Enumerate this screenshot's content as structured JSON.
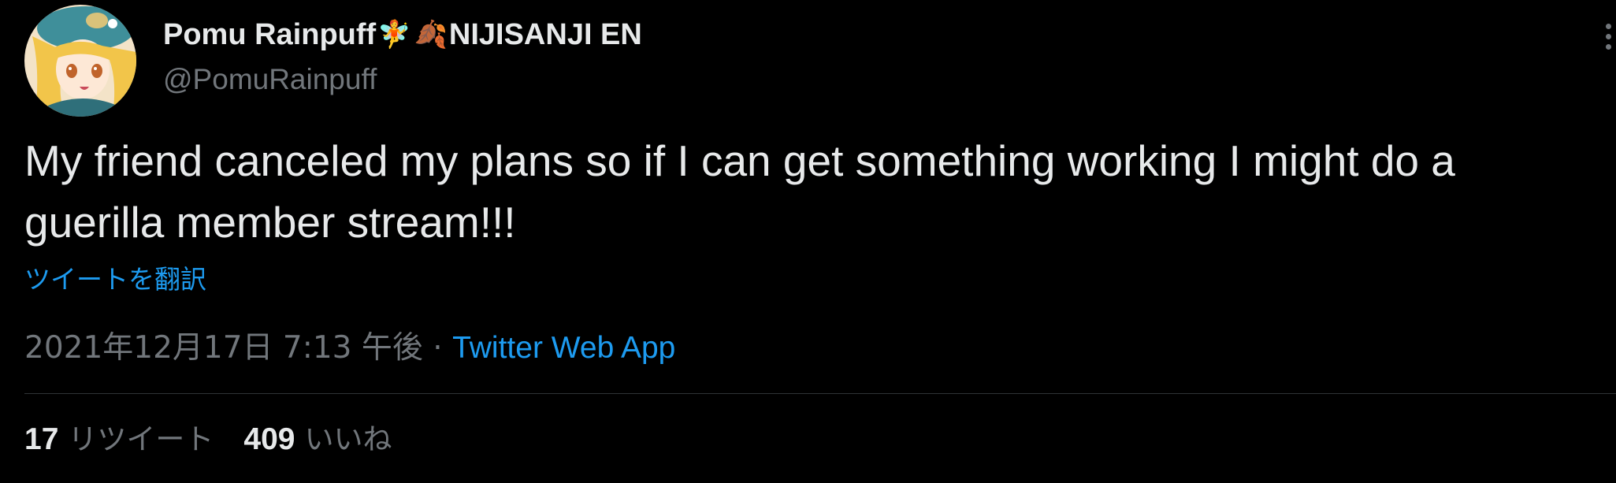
{
  "author": {
    "display_name": "Pomu Rainpuff",
    "name_emojis": [
      "🧚",
      "🍂"
    ],
    "name_suffix": "NIJISANJI EN",
    "handle": "@PomuRainpuff"
  },
  "tweet": {
    "text": "My friend canceled my plans so if I can get something working I might do a guerilla member stream!!!",
    "translate_label": "ツイートを翻訳",
    "timestamp": "2021年12月17日 7:13 午後",
    "separator": " · ",
    "source": "Twitter Web App"
  },
  "stats": {
    "retweets_count": "17",
    "retweets_label": "リツイート",
    "likes_count": "409",
    "likes_label": "いいね"
  },
  "colors": {
    "background": "#000000",
    "text_primary": "#e7e9ea",
    "text_secondary": "#71767b",
    "link": "#1d9bf0",
    "divider": "#2f3336"
  },
  "icons": {
    "more": "more-vertical-icon",
    "avatar": "avatar-image"
  }
}
